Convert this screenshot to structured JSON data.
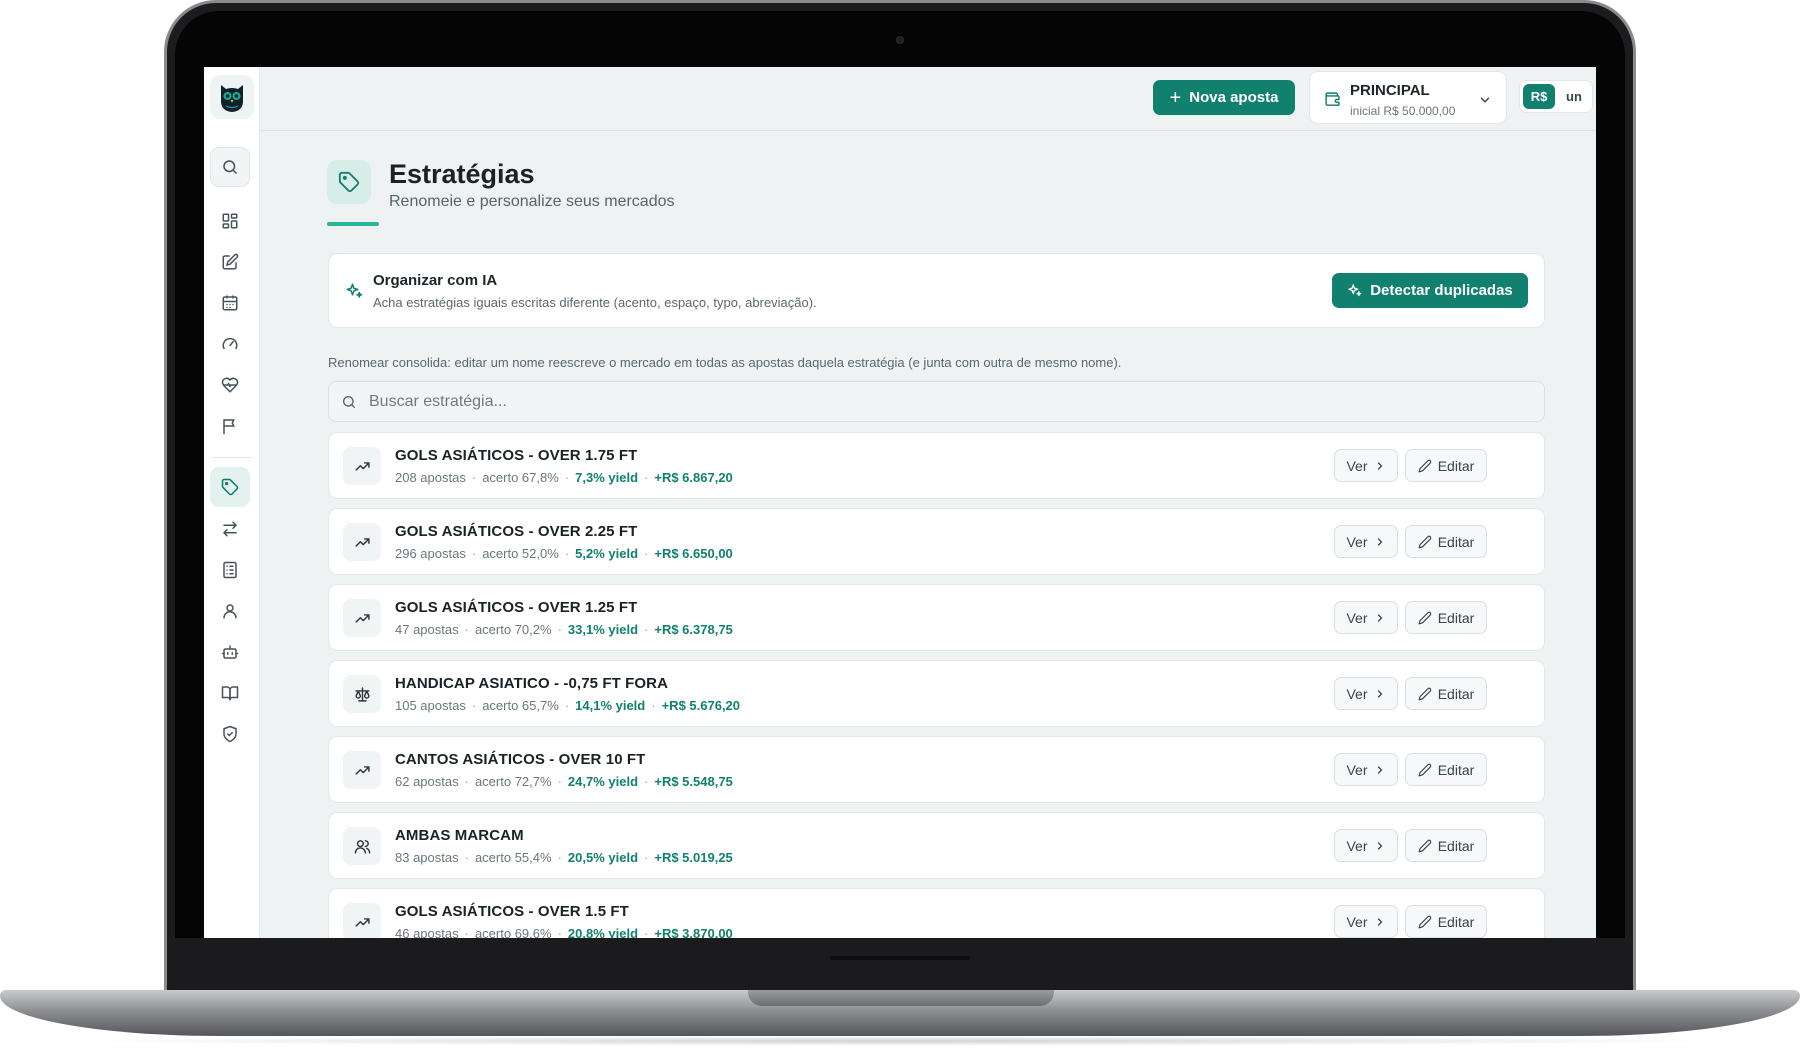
{
  "header": {
    "new_bet_label": "Nova aposta",
    "account_name": "PRINCIPAL",
    "account_initial": "inicial R$ 50.000,00",
    "currency_active": "R$",
    "currency_other": "un"
  },
  "page": {
    "title": "Estratégias",
    "subtitle": "Renomeie e personalize seus mercados"
  },
  "ai_card": {
    "title": "Organizar com IA",
    "description": "Acha estratégias iguais escritas diferente (acento, espaço, typo, abreviação).",
    "button_label": "Detectar duplicadas"
  },
  "info_line": "Renomear consolida: editar um nome reescreve o mercado em todas as apostas daquela estratégia (e junta com outra de mesmo nome).",
  "search": {
    "placeholder": "Buscar estratégia..."
  },
  "actions": {
    "view_label": "Ver",
    "edit_label": "Editar"
  },
  "colors": {
    "accent": "#12806f",
    "accent_light": "#29b49c",
    "background": "#eef2f3"
  },
  "strategies": [
    {
      "name": "GOLS ASIÁTICOS - OVER 1.75 FT",
      "bets": "208 apostas",
      "hit": "acerto 67,8%",
      "yield": "7,3% yield",
      "profit": "+R$ 6.867,20",
      "icon": "trending-up-icon"
    },
    {
      "name": "GOLS ASIÁTICOS - OVER 2.25 FT",
      "bets": "296 apostas",
      "hit": "acerto 52,0%",
      "yield": "5,2% yield",
      "profit": "+R$ 6.650,00",
      "icon": "trending-up-icon"
    },
    {
      "name": "GOLS ASIÁTICOS - OVER 1.25 FT",
      "bets": "47 apostas",
      "hit": "acerto 70,2%",
      "yield": "33,1% yield",
      "profit": "+R$ 6.378,75",
      "icon": "trending-up-icon"
    },
    {
      "name": "HANDICAP ASIATICO - -0,75 FT FORA",
      "bets": "105 apostas",
      "hit": "acerto 65,7%",
      "yield": "14,1% yield",
      "profit": "+R$ 5.676,20",
      "icon": "scale-icon"
    },
    {
      "name": "CANTOS ASIÁTICOS - OVER 10 FT",
      "bets": "62 apostas",
      "hit": "acerto 72,7%",
      "yield": "24,7% yield",
      "profit": "+R$ 5.548,75",
      "icon": "trending-up-icon"
    },
    {
      "name": "AMBAS MARCAM",
      "bets": "83 apostas",
      "hit": "acerto 55,4%",
      "yield": "20,5% yield",
      "profit": "+R$ 5.019,25",
      "icon": "users-icon"
    },
    {
      "name": "GOLS ASIÁTICOS - OVER 1.5 FT",
      "bets": "46 apostas",
      "hit": "acerto 69,6%",
      "yield": "20,8% yield",
      "profit": "+R$ 3.870,00",
      "icon": "trending-up-icon"
    }
  ]
}
